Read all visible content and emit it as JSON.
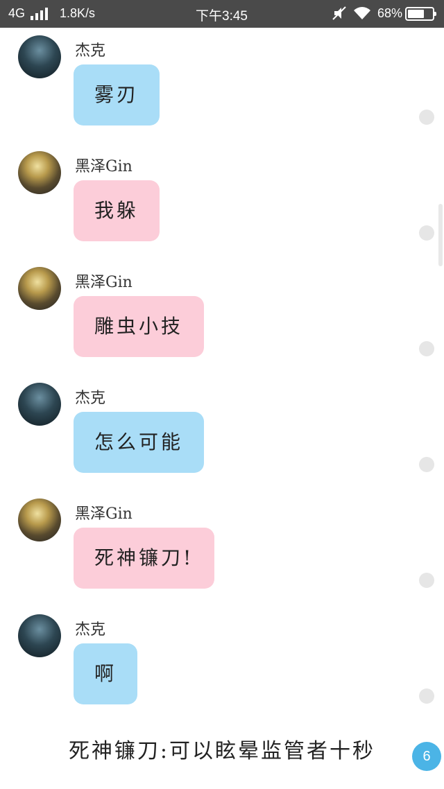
{
  "status_bar": {
    "network": "4G",
    "speed": "1.8K/s",
    "time": "下午3:45",
    "battery_percent": "68%",
    "battery_level": 0.68,
    "icons": [
      "signal-icon",
      "mute-icon",
      "wifi-icon",
      "battery-icon"
    ]
  },
  "messages": [
    {
      "sender": "杰克",
      "text": "雾刃",
      "avatar": "jack",
      "bubble_color": "#a9ddf7"
    },
    {
      "sender": "黑泽Gin",
      "text": "我躲",
      "avatar": "gin",
      "bubble_color": "#fccdd9"
    },
    {
      "sender": "黑泽Gin",
      "text": "雕虫小技",
      "avatar": "gin",
      "bubble_color": "#fccdd9"
    },
    {
      "sender": "杰克",
      "text": "怎么可能",
      "avatar": "jack",
      "bubble_color": "#a9ddf7"
    },
    {
      "sender": "黑泽Gin",
      "text": "死神镰刀!",
      "avatar": "gin",
      "bubble_color": "#fccdd9"
    },
    {
      "sender": "杰克",
      "text": "啊",
      "avatar": "jack",
      "bubble_color": "#a9ddf7"
    }
  ],
  "caption": "死神镰刀:可以眩晕监管者十秒",
  "page_badge": "6"
}
